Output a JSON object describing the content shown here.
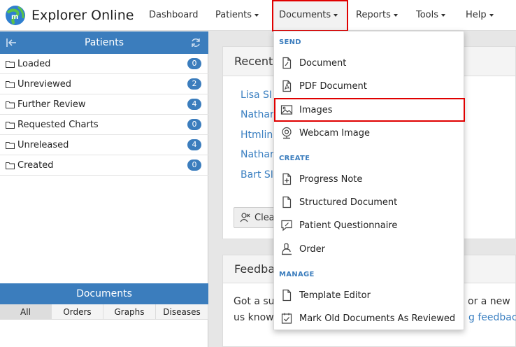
{
  "app": {
    "title": "Explorer Online"
  },
  "nav": {
    "items": [
      {
        "label": "Dashboard",
        "dropdown": false
      },
      {
        "label": "Patients",
        "dropdown": true
      },
      {
        "label": "Documents",
        "dropdown": true
      },
      {
        "label": "Reports",
        "dropdown": true
      },
      {
        "label": "Tools",
        "dropdown": true
      },
      {
        "label": "Help",
        "dropdown": true
      }
    ]
  },
  "patients_panel": {
    "title": "Patients",
    "lists": [
      {
        "label": "Loaded",
        "count": "0"
      },
      {
        "label": "Unreviewed",
        "count": "2"
      },
      {
        "label": "Further Review",
        "count": "4"
      },
      {
        "label": "Requested Charts",
        "count": "0"
      },
      {
        "label": "Unreleased",
        "count": "4"
      },
      {
        "label": "Created",
        "count": "0"
      }
    ]
  },
  "documents_panel": {
    "title": "Documents",
    "tabs": [
      "All",
      "Orders",
      "Graphs",
      "Diseases"
    ],
    "active_tab": "All"
  },
  "recent_card": {
    "title": "Recent",
    "links": [
      "Lisa SI",
      "Nathar",
      "Htmlin",
      "Nathar",
      "Bart SI"
    ],
    "clear_label": "Clea"
  },
  "feedback_card": {
    "title": "Feedba",
    "line1_left": "Got a su",
    "line1_right": "or a new",
    "line2_left": "us know",
    "line2_link": "g feedbac"
  },
  "documents_menu": {
    "sections": [
      {
        "label": "SEND",
        "items": [
          {
            "label": "Document",
            "icon": "document-icon"
          },
          {
            "label": "PDF Document",
            "icon": "pdf-icon"
          },
          {
            "label": "Images",
            "icon": "image-icon"
          },
          {
            "label": "Webcam Image",
            "icon": "webcam-icon"
          }
        ]
      },
      {
        "label": "CREATE",
        "items": [
          {
            "label": "Progress Note",
            "icon": "progress-note-icon"
          },
          {
            "label": "Structured Document",
            "icon": "structured-document-icon"
          },
          {
            "label": "Patient Questionnaire",
            "icon": "questionnaire-icon"
          },
          {
            "label": "Order",
            "icon": "order-icon"
          }
        ]
      },
      {
        "label": "MANAGE",
        "items": [
          {
            "label": "Template Editor",
            "icon": "template-editor-icon"
          },
          {
            "label": "Mark Old Documents As Reviewed",
            "icon": "mark-reviewed-icon"
          }
        ]
      }
    ]
  },
  "colors": {
    "accent": "#3b7dbd",
    "link": "#3a7fc1",
    "highlight_box": "#e00000"
  }
}
